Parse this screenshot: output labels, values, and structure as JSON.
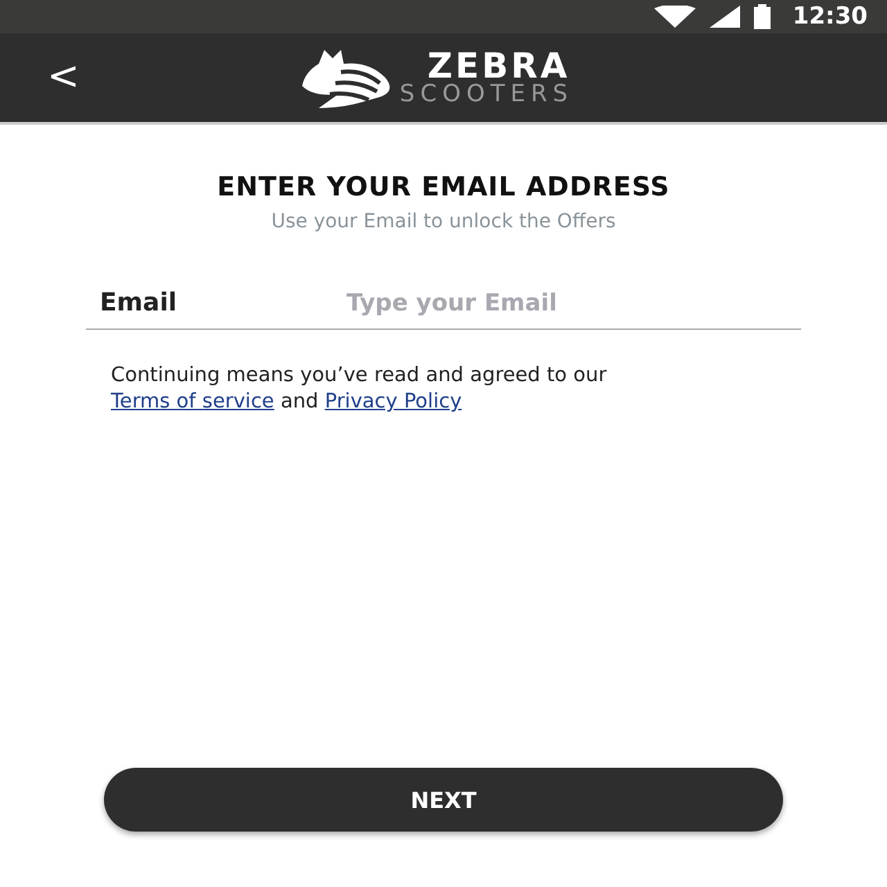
{
  "status_bar": {
    "time": "12:30"
  },
  "header": {
    "back": "<",
    "brand": "ZEBRA",
    "sub_brand": "SCOOTERS"
  },
  "title": "ENTER YOUR EMAIL ADDRESS",
  "subtitle": "Use your Email to unlock the Offers",
  "email_field": {
    "label": "Email",
    "placeholder": "Type your Email"
  },
  "consent": [
    {
      "kind": "text",
      "text": "Continuing means you’ve read and agreed to our "
    },
    {
      "kind": "link",
      "text": "Terms of service"
    },
    {
      "kind": "text",
      "text": " and "
    },
    {
      "kind": "link",
      "text": "Privacy Policy"
    }
  ],
  "next_button": "NEXT"
}
